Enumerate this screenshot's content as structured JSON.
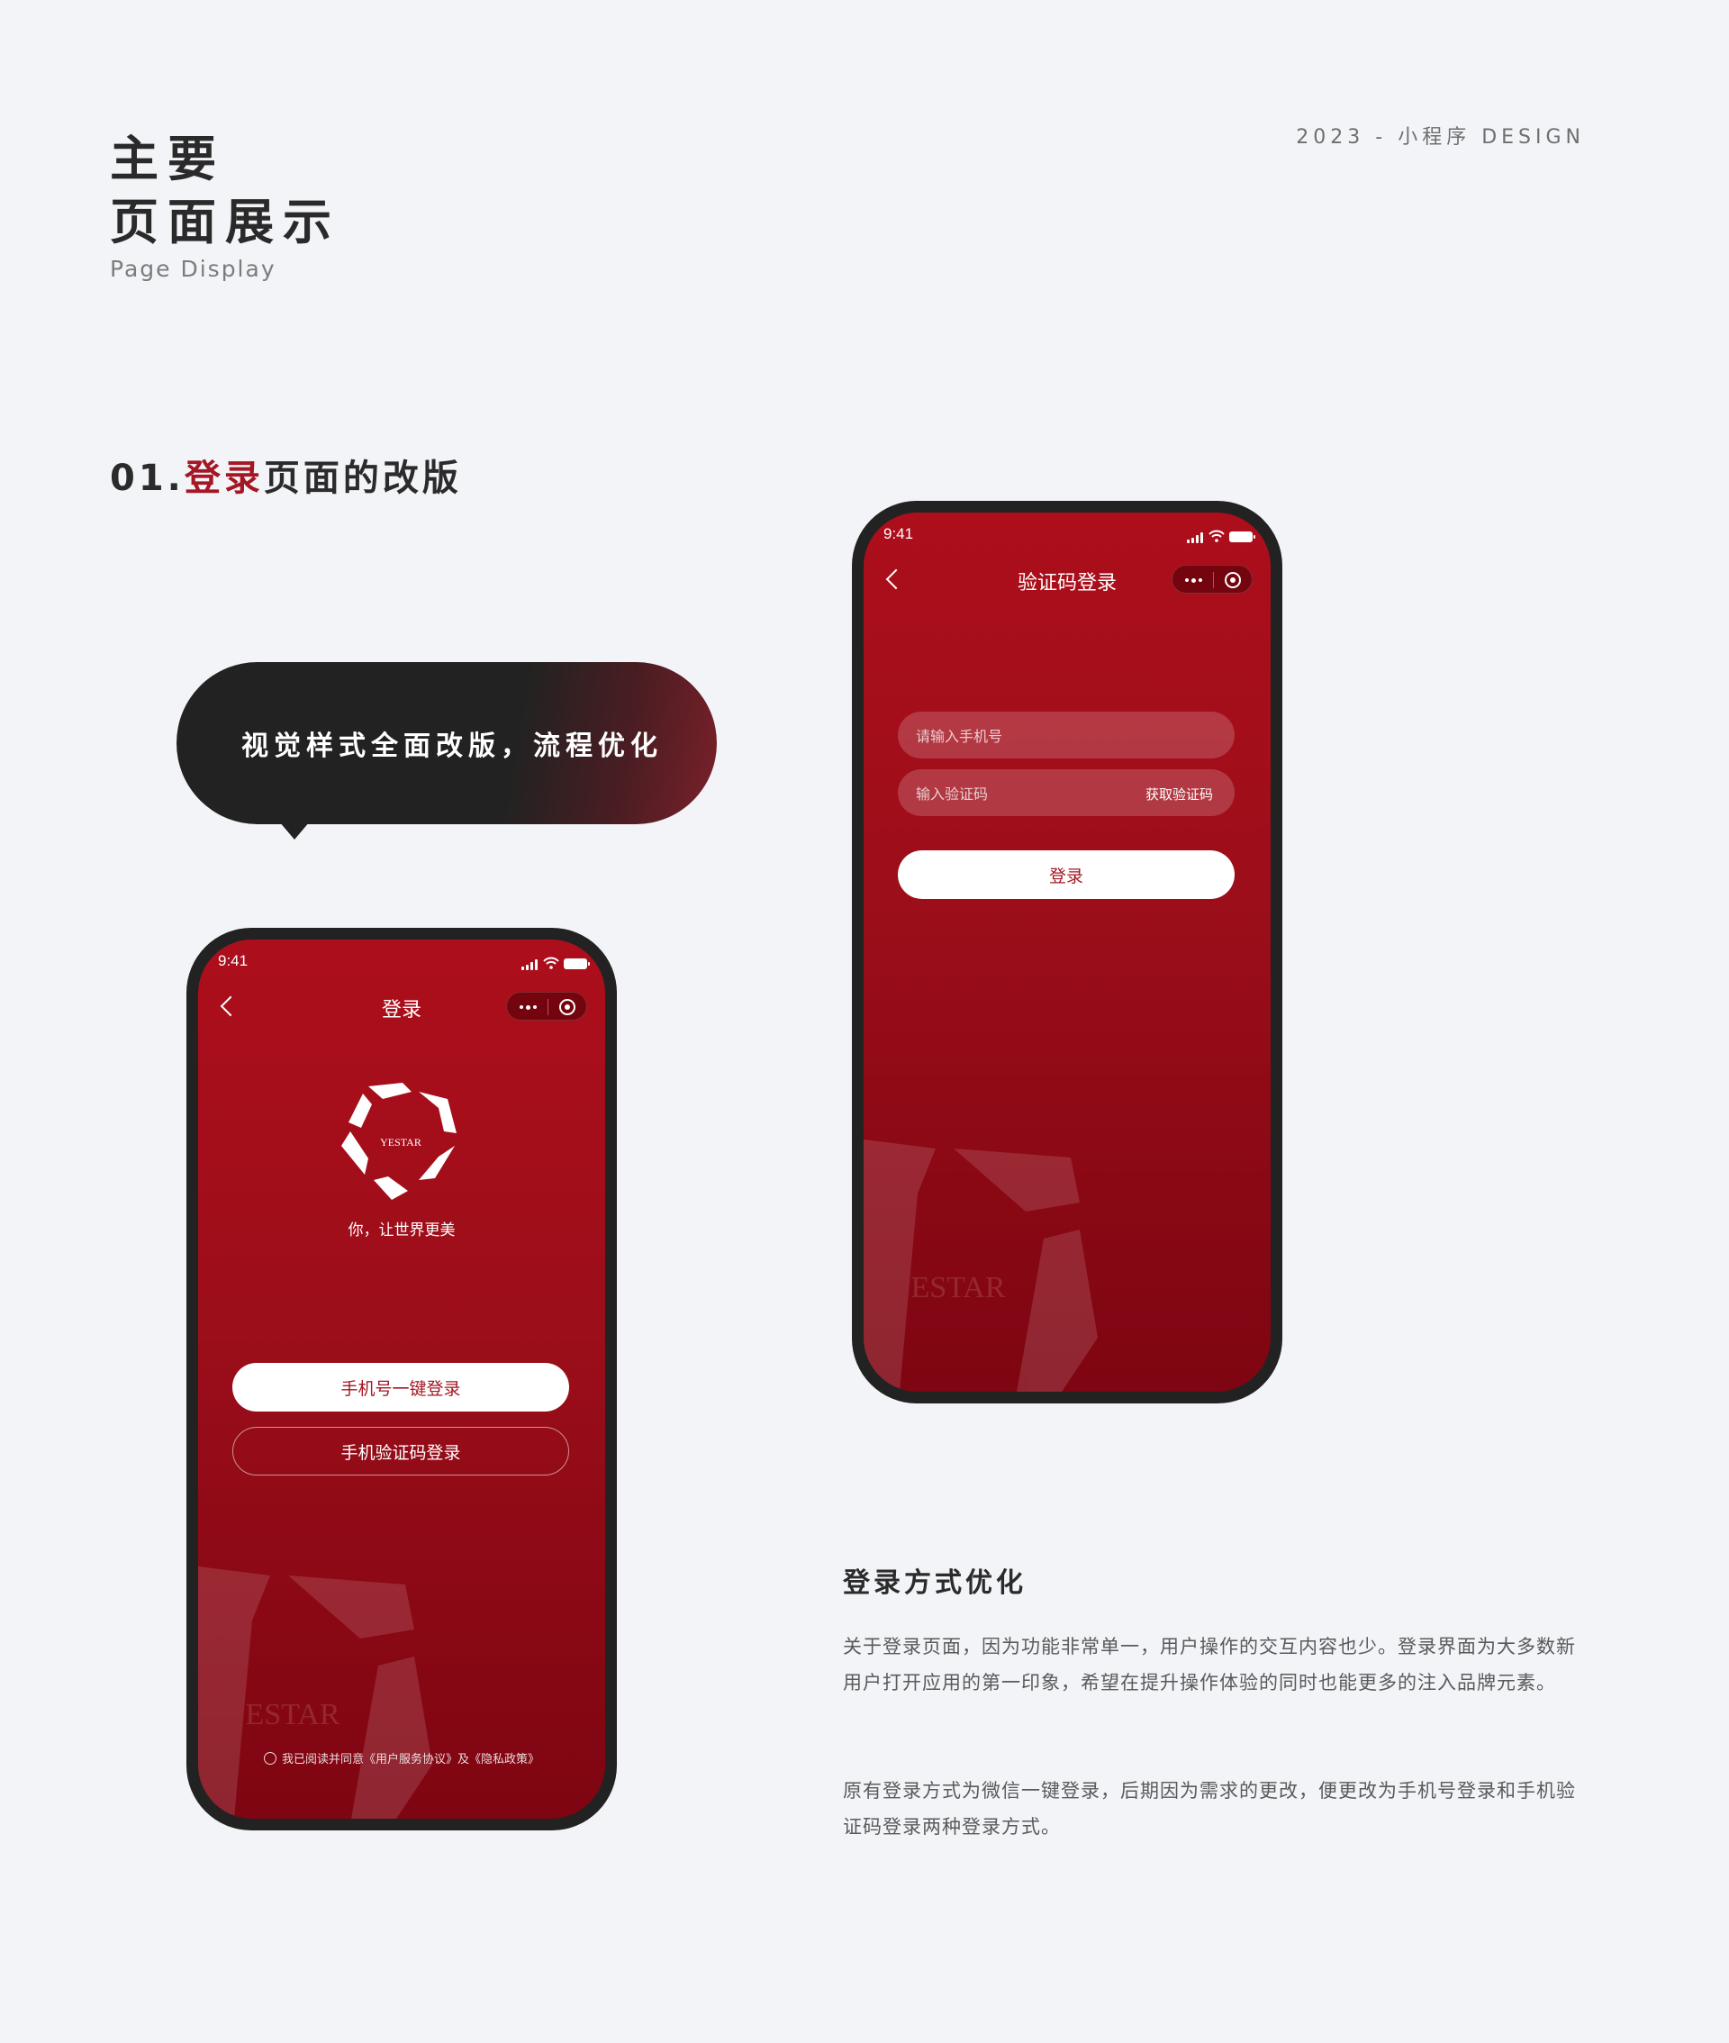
{
  "header": {
    "title_line1": "主要",
    "title_line2": "页面展示",
    "subtitle": "Page Display",
    "meta": "2023 - 小程序 DESIGN"
  },
  "section": {
    "number": "01.",
    "highlight": "登录",
    "rest": "页面的改版"
  },
  "bubble": {
    "text": "视觉样式全面改版，流程优化"
  },
  "phone_login": {
    "time": "9:41",
    "title": "登录",
    "logo_text": "YESTAR",
    "slogan": "你，让世界更美",
    "primary_button": "手机号一键登录",
    "secondary_button": "手机验证码登录",
    "agreement": "我已阅读并同意《用户服务协议》及《隐私政策》",
    "watermark": "YESTAR"
  },
  "phone_code": {
    "time": "9:41",
    "title": "验证码登录",
    "phone_placeholder": "请输入手机号",
    "code_placeholder": "输入验证码",
    "get_code": "获取验证码",
    "login_button": "登录",
    "watermark": "YESTAR"
  },
  "description": {
    "title": "登录方式优化",
    "para1": "关于登录页面，因为功能非常单一，用户操作的交互内容也少。登录界面为大多数新用户打开应用的第一印象，希望在提升操作体验的同时也能更多的注入品牌元素。",
    "para2": "原有登录方式为微信一键登录，后期因为需求的更改，便更改为手机号登录和手机验证码登录两种登录方式。"
  },
  "colors": {
    "background": "#f3f4f8",
    "brand_red": "#a51724",
    "dark": "#222222"
  }
}
